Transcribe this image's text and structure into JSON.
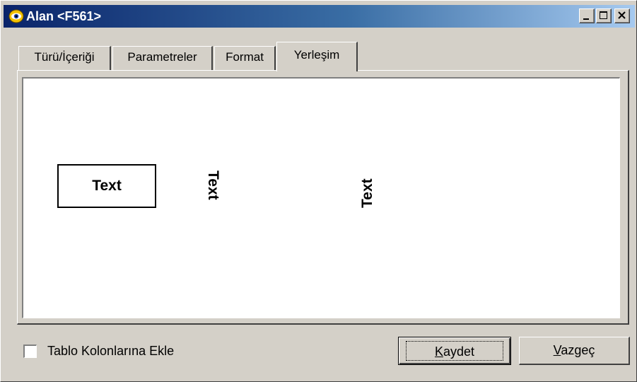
{
  "window": {
    "title": "Alan <F561>",
    "buttons": [
      "minimize-icon",
      "maximize-icon",
      "close-icon"
    ]
  },
  "tabs": [
    {
      "label": "Türü/İçeriği",
      "active": false
    },
    {
      "label": "Parametreler",
      "active": false
    },
    {
      "label": "Format",
      "active": false
    },
    {
      "label": "Yerleşim",
      "active": true
    }
  ],
  "layout_preview": {
    "horizontal_text": "Text",
    "vertical_down_text": "Text",
    "vertical_up_text": "Text"
  },
  "footer": {
    "checkbox_label": "Tablo Kolonlarına Ekle",
    "checkbox_checked": false,
    "save_label_accel": "K",
    "save_label_rest": "aydet",
    "cancel_label_accel": "V",
    "cancel_label_rest": "azgeç"
  }
}
